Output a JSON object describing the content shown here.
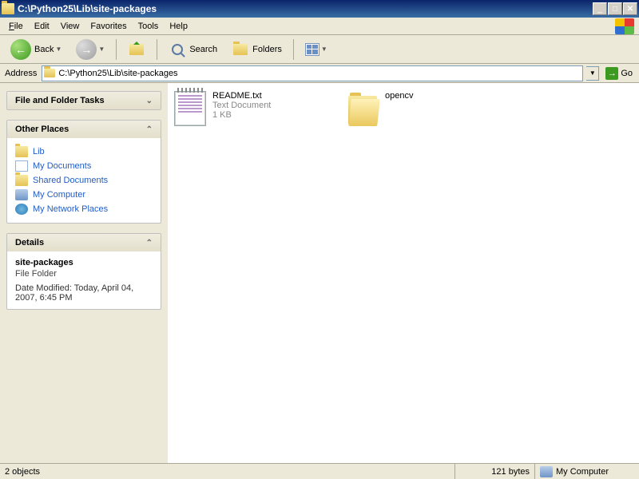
{
  "window": {
    "title": "C:\\Python25\\Lib\\site-packages"
  },
  "menu": {
    "file": "File",
    "edit": "Edit",
    "view": "View",
    "favorites": "Favorites",
    "tools": "Tools",
    "help": "Help"
  },
  "toolbar": {
    "back": "Back",
    "search": "Search",
    "folders": "Folders"
  },
  "address": {
    "label": "Address",
    "value": "C:\\Python25\\Lib\\site-packages",
    "go": "Go"
  },
  "tasks": {
    "fft": "File and Folder Tasks",
    "other": "Other Places",
    "details_hdr": "Details",
    "places": [
      {
        "label": "Lib",
        "icon": "folder"
      },
      {
        "label": "My Documents",
        "icon": "docs"
      },
      {
        "label": "Shared Documents",
        "icon": "folder"
      },
      {
        "label": "My Computer",
        "icon": "comp"
      },
      {
        "label": "My Network Places",
        "icon": "net"
      }
    ],
    "details": {
      "name": "site-packages",
      "type": "File Folder",
      "modified": "Date Modified: Today, April 04, 2007, 6:45 PM"
    }
  },
  "files": [
    {
      "name": "README.txt",
      "type": "Text Document",
      "size": "1 KB",
      "kind": "txt"
    },
    {
      "name": "opencv",
      "type": "",
      "size": "",
      "kind": "folder"
    }
  ],
  "status": {
    "objects": "2 objects",
    "bytes": "121 bytes",
    "zone": "My Computer"
  }
}
